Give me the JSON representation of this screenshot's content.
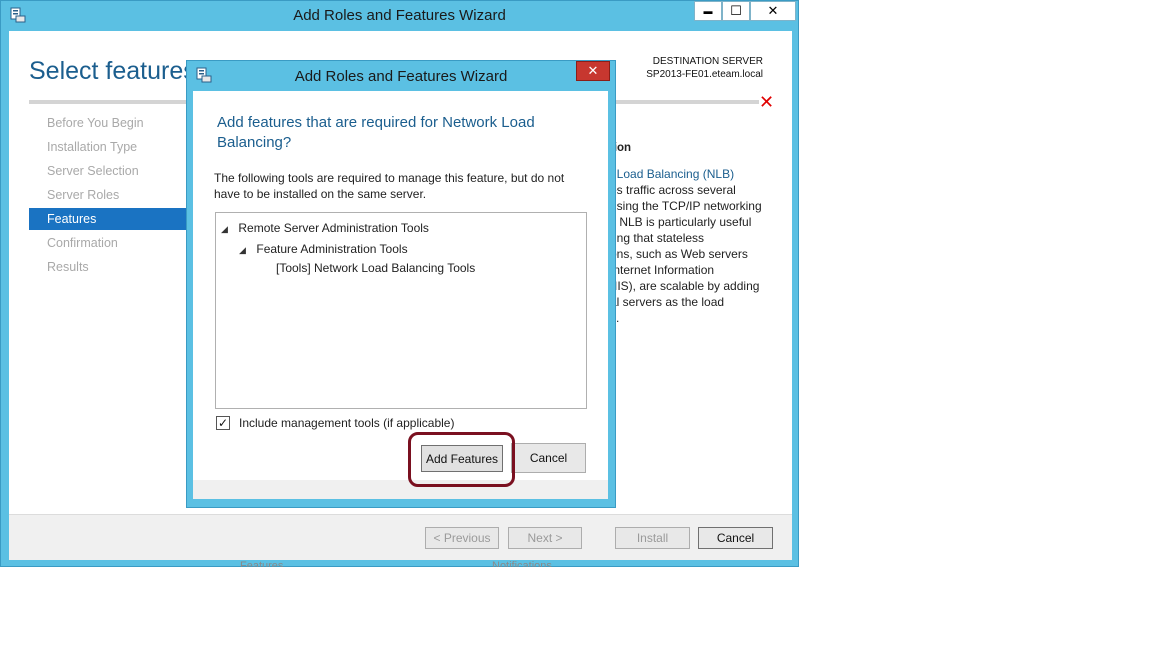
{
  "main_window": {
    "title": "Add Roles and Features Wizard",
    "minimize_glyph": "▬",
    "maximize_glyph": "☐",
    "close_glyph": "✕"
  },
  "page": {
    "title": "Select features",
    "destination_label": "DESTINATION SERVER",
    "destination_server": "SP2013-FE01.eteam.local",
    "error_glyph": "✕"
  },
  "nav": {
    "items": [
      {
        "label": "Before You Begin",
        "active": false
      },
      {
        "label": "Installation Type",
        "active": false
      },
      {
        "label": "Server Selection",
        "active": false
      },
      {
        "label": "Server Roles",
        "active": false
      },
      {
        "label": "Features",
        "active": true
      },
      {
        "label": "Confirmation",
        "active": false
      },
      {
        "label": "Results",
        "active": false
      }
    ]
  },
  "description": {
    "heading": "tion",
    "link": "t Load Balancing (NLB)",
    "lines": [
      "es traffic across several",
      "using the TCP/IP networking",
      "l. NLB is particularly useful",
      "ring that stateless",
      "ons, such as Web servers",
      "Internet Information",
      "(IIS), are scalable by adding",
      "al servers as the load",
      "s."
    ]
  },
  "footer": {
    "previous": "< Previous",
    "next": "Next >",
    "install": "Install",
    "cancel": "Cancel"
  },
  "background_fragments": {
    "left": "Features",
    "right": "Notifications"
  },
  "dialog": {
    "title": "Add Roles and Features Wizard",
    "close_glyph": "✕",
    "heading": "Add features that are required for Network Load Balancing?",
    "description": "The following tools are required to manage this feature, but do not have to be installed on the same server.",
    "tree": [
      {
        "label": "Remote Server Administration Tools",
        "level": 0,
        "expander": "◢"
      },
      {
        "label": "Feature Administration Tools",
        "level": 1,
        "expander": "◢"
      },
      {
        "label": "[Tools] Network Load Balancing Tools",
        "level": 2,
        "expander": ""
      }
    ],
    "checkbox": {
      "label": "Include management tools (if applicable)",
      "checked": true,
      "glyph": "✓"
    },
    "add_button": "Add Features",
    "cancel_button": "Cancel"
  },
  "colors": {
    "window_frame": "#5bc0e3",
    "accent_blue": "#1a73c2",
    "heading_blue": "#1b5e8e",
    "close_red": "#c7372f",
    "highlight_ring": "#7a1020",
    "error_red": "#e00000"
  }
}
